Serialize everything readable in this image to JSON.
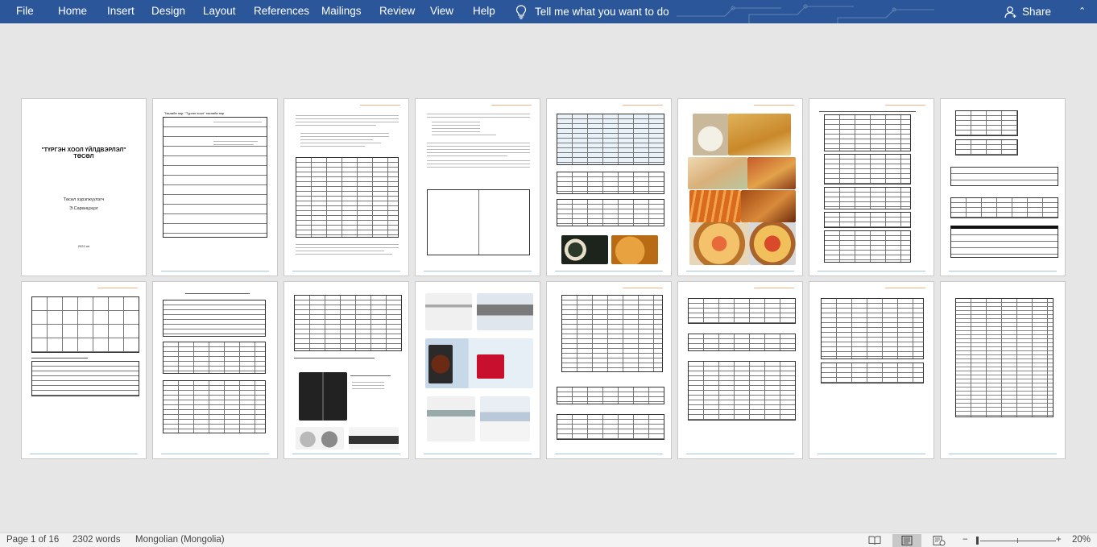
{
  "ribbon": {
    "tabs": [
      "File",
      "Home",
      "Insert",
      "Design",
      "Layout",
      "References",
      "Mailings",
      "Review",
      "View",
      "Help"
    ],
    "tell_me": "Tell me what you want to do",
    "share": "Share",
    "icons": {
      "tell_me": "lightbulb-icon",
      "share": "person-icon",
      "collapse": "chevron-up-icon"
    },
    "colors": {
      "ribbon_bg": "#2b579a",
      "ribbon_text": "#ffffff"
    }
  },
  "document": {
    "cover": {
      "title_line1": "\"ТҮРГЭН ХООЛ ҮЙЛДВЭРЛЭЛ\"",
      "title_line2": "ТӨСӨЛ",
      "author_role": "Төсөл хэрэгжүүлэгч",
      "author_name": "Э.Саранцэцэг",
      "year": "2022 он"
    },
    "page2_title": "Төслийн нэр: \"Түргэн хоол\" төслийн нэр"
  },
  "status": {
    "page": "Page 1 of 16",
    "words": "2302 words",
    "language": "Mongolian (Mongolia)",
    "zoom": "20%",
    "zoom_minus": "−",
    "zoom_plus": "+",
    "zoom_level": 0.2
  }
}
